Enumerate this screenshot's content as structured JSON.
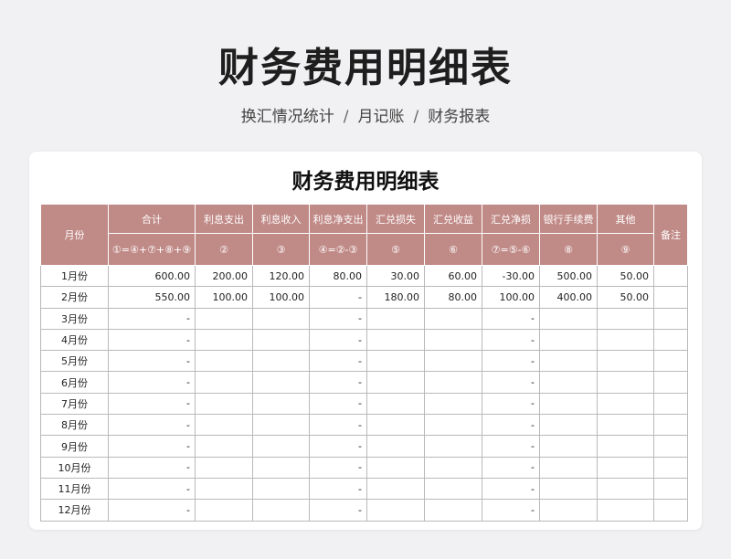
{
  "page": {
    "title": "财务费用明细表",
    "breadcrumb": [
      "换汇情况统计",
      "月记账",
      "财务报表"
    ],
    "separator": "/"
  },
  "sheet": {
    "title": "财务费用明细表",
    "header_color": "#c08a87",
    "columns": {
      "month": "月份",
      "total": "合计",
      "interest_expense": "利息支出",
      "interest_income": "利息收入",
      "net_interest": "利息净支出",
      "fx_loss": "汇兑损失",
      "fx_gain": "汇兑收益",
      "fx_net": "汇兑净损",
      "bank_fee": "银行手续费",
      "other": "其他",
      "note": "备注"
    },
    "formulas": {
      "total": "①=④+⑦+⑧+⑨",
      "interest_expense": "②",
      "interest_income": "③",
      "net_interest": "④=②-③",
      "fx_loss": "⑤",
      "fx_gain": "⑥",
      "fx_net": "⑦=⑤-⑥",
      "bank_fee": "⑧",
      "other": "⑨"
    },
    "rows": [
      [
        "1月份",
        "600.00",
        "200.00",
        "120.00",
        "80.00",
        "30.00",
        "60.00",
        "-30.00",
        "500.00",
        "50.00",
        ""
      ],
      [
        "2月份",
        "550.00",
        "100.00",
        "100.00",
        "-",
        "180.00",
        "80.00",
        "100.00",
        "400.00",
        "50.00",
        ""
      ],
      [
        "3月份",
        "-",
        "",
        "",
        "-",
        "",
        "",
        "-",
        "",
        "",
        ""
      ],
      [
        "4月份",
        "-",
        "",
        "",
        "-",
        "",
        "",
        "-",
        "",
        "",
        ""
      ],
      [
        "5月份",
        "-",
        "",
        "",
        "-",
        "",
        "",
        "-",
        "",
        "",
        ""
      ],
      [
        "6月份",
        "-",
        "",
        "",
        "-",
        "",
        "",
        "-",
        "",
        "",
        ""
      ],
      [
        "7月份",
        "-",
        "",
        "",
        "-",
        "",
        "",
        "-",
        "",
        "",
        ""
      ],
      [
        "8月份",
        "-",
        "",
        "",
        "-",
        "",
        "",
        "-",
        "",
        "",
        ""
      ],
      [
        "9月份",
        "-",
        "",
        "",
        "-",
        "",
        "",
        "-",
        "",
        "",
        ""
      ],
      [
        "10月份",
        "-",
        "",
        "",
        "-",
        "",
        "",
        "-",
        "",
        "",
        ""
      ],
      [
        "11月份",
        "-",
        "",
        "",
        "-",
        "",
        "",
        "-",
        "",
        "",
        ""
      ],
      [
        "12月份",
        "-",
        "",
        "",
        "-",
        "",
        "",
        "-",
        "",
        "",
        ""
      ]
    ]
  }
}
